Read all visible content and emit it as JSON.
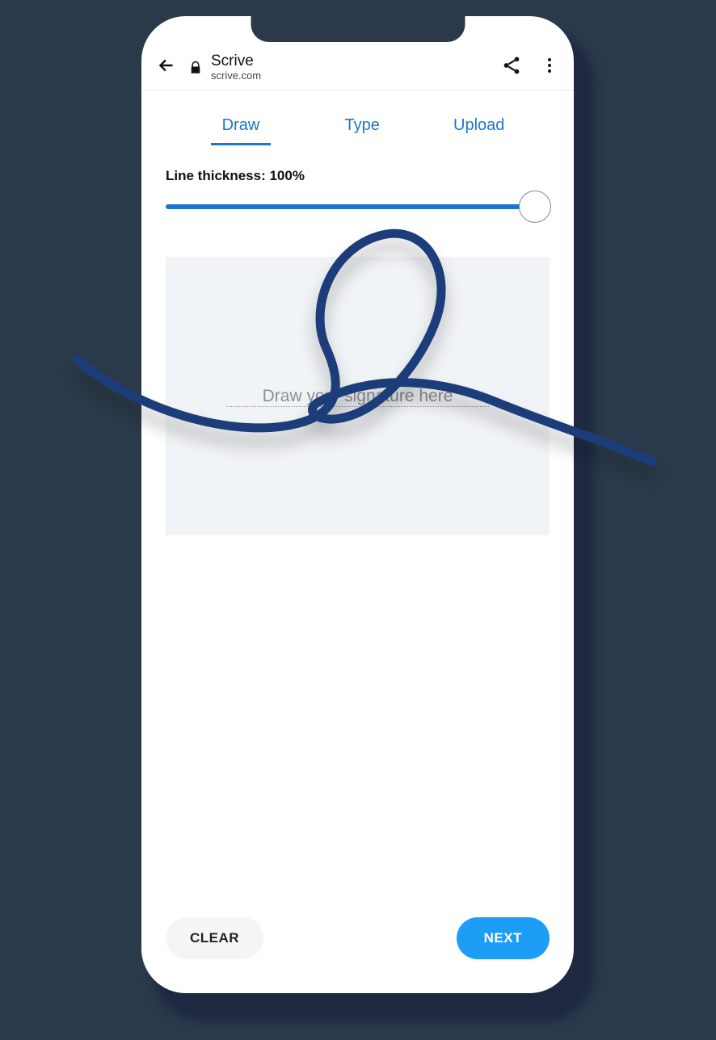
{
  "browser": {
    "site_name": "Scrive",
    "site_url": "scrive.com"
  },
  "tabs": [
    {
      "label": "Draw",
      "active": true
    },
    {
      "label": "Type",
      "active": false
    },
    {
      "label": "Upload",
      "active": false
    }
  ],
  "thickness": {
    "label": "Line thickness: 100%",
    "value": 100
  },
  "canvas": {
    "placeholder": "Draw your signature here"
  },
  "footer": {
    "clear_label": "CLEAR",
    "next_label": "NEXT"
  },
  "colors": {
    "accent": "#1976d2",
    "next_button": "#1e9df7",
    "signature": "#1f3d7a"
  }
}
